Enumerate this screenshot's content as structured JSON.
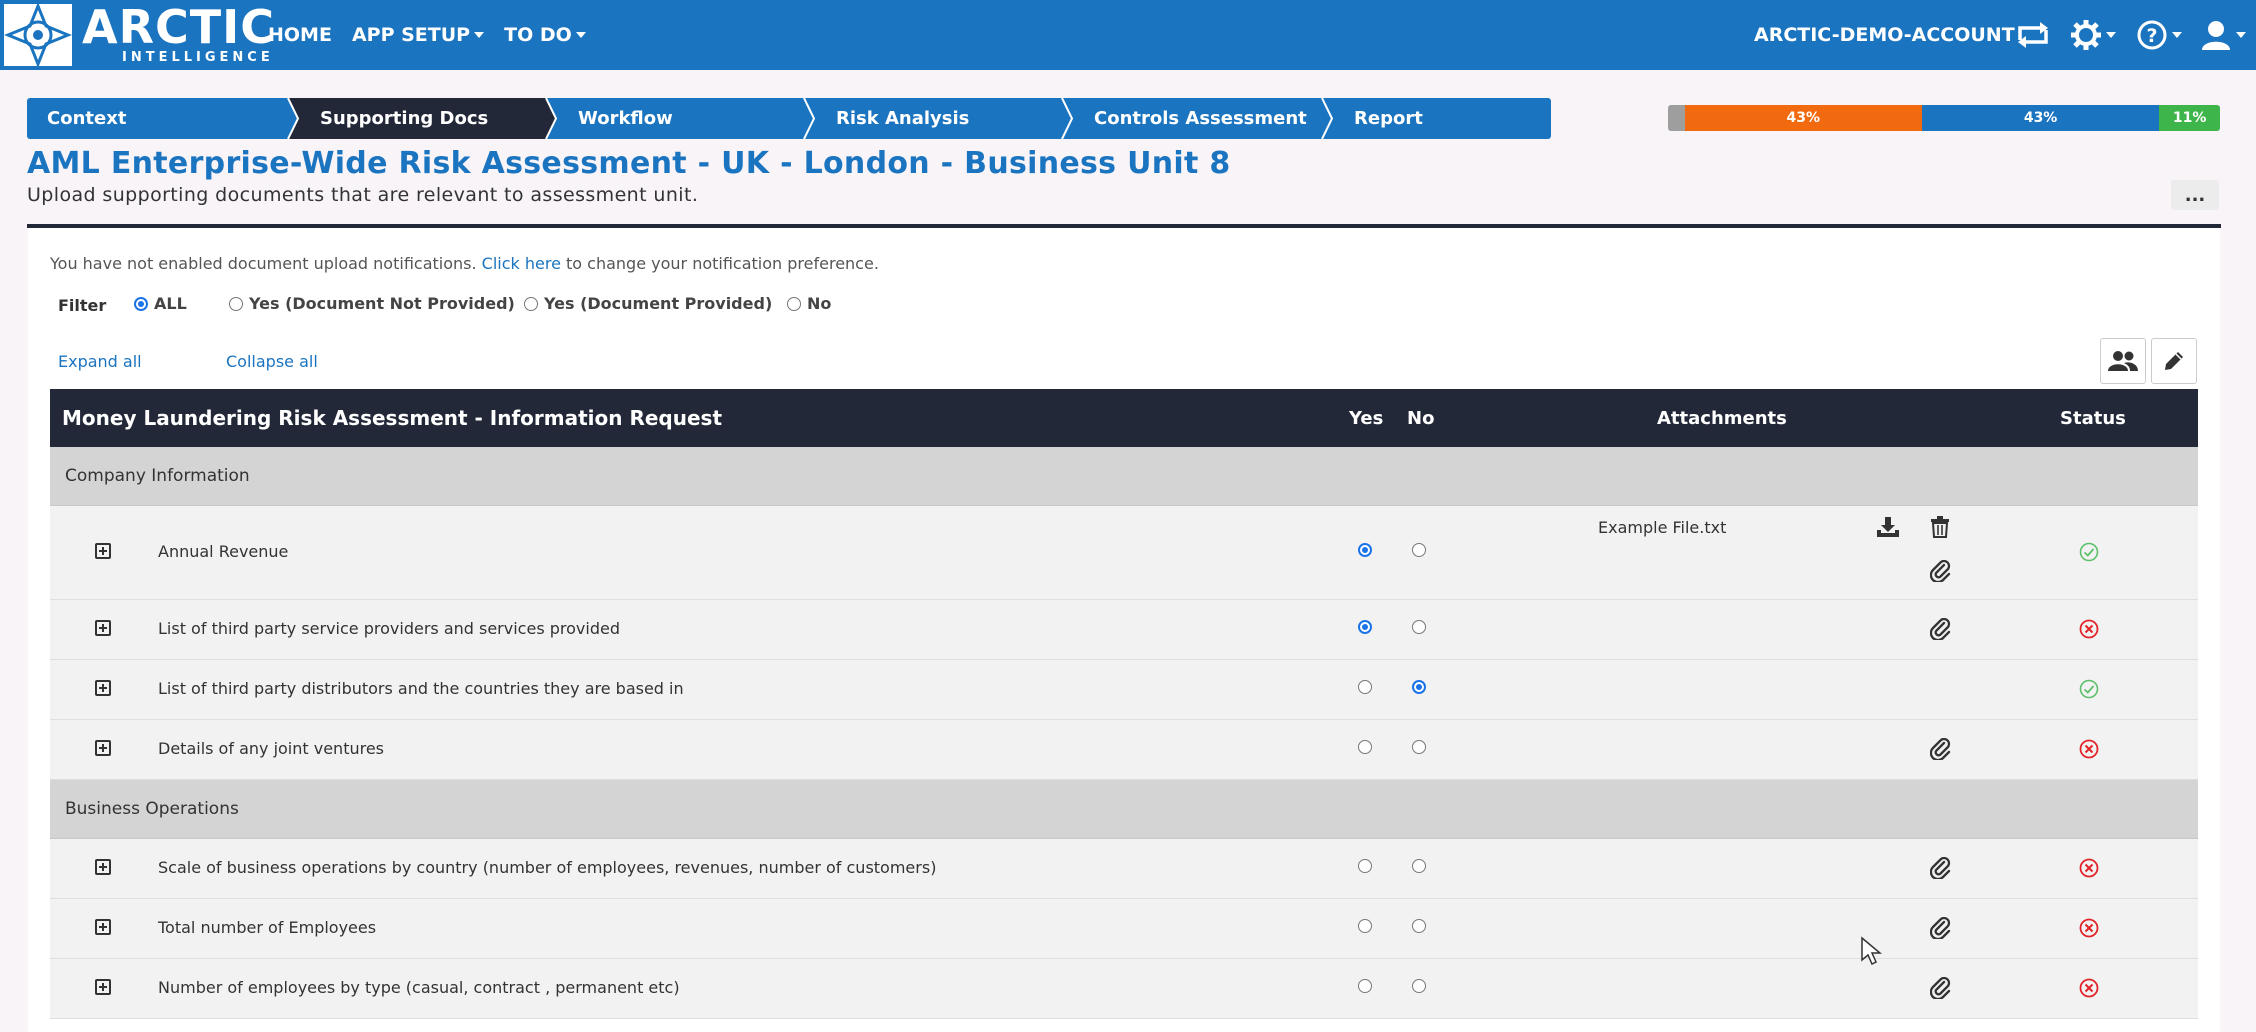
{
  "brand": {
    "name": "ARCTIC",
    "tagline": "INTELLIGENCE"
  },
  "nav": {
    "home": "HOME",
    "app_setup": "APP SETUP",
    "todo": "TO DO"
  },
  "account": {
    "name": "ARCTIC-DEMO-ACCOUNT"
  },
  "icons": {
    "switch": "switch-account-icon",
    "settings": "gear-icon",
    "help": "help-icon",
    "user": "user-icon",
    "download": "download-icon",
    "trash": "trash-icon",
    "attach": "paperclip-icon",
    "ok": "check-circle-icon",
    "missing": "x-circle-icon"
  },
  "steps": [
    "Context",
    "Supporting Docs",
    "Workflow",
    "Risk Analysis",
    "Controls Assessment",
    "Report"
  ],
  "active_step": 1,
  "progress": [
    {
      "label": "",
      "percent": 3,
      "color": "#9e9e9e"
    },
    {
      "label": "43%",
      "percent": 43,
      "color": "#f26a0f"
    },
    {
      "label": "43%",
      "percent": 43,
      "color": "#1b74c0"
    },
    {
      "label": "11%",
      "percent": 11,
      "color": "#3db54a"
    }
  ],
  "page": {
    "title": "AML Enterprise-Wide Risk Assessment - UK - London - Business Unit 8",
    "subtitle": "Upload supporting documents that are relevant to assessment unit.",
    "more_label": "..."
  },
  "notice": {
    "before": "You have not enabled document upload notifications.",
    "link": "Click here",
    "after": "to change your notification preference."
  },
  "filter": {
    "label": "Filter",
    "options": [
      "ALL",
      "Yes (Document Not Provided)",
      "Yes (Document Provided)",
      "No"
    ],
    "selected": "ALL"
  },
  "links": {
    "expand_all": "Expand all",
    "collapse_all": "Collapse all"
  },
  "table": {
    "title": "Money Laundering Risk Assessment - Information Request",
    "col_yes": "Yes",
    "col_no": "No",
    "col_attachments": "Attachments",
    "col_status": "Status",
    "sections": [
      {
        "name": "Company Information",
        "rows": [
          {
            "label": "Annual Revenue",
            "answer": "yes",
            "file": "Example File.txt",
            "status": "ok"
          },
          {
            "label": "List of third party service providers and services provided",
            "answer": "yes",
            "file": "",
            "status": "missing"
          },
          {
            "label": "List of third party distributors and the countries they are based in",
            "answer": "no",
            "file": "",
            "status": "ok"
          },
          {
            "label": "Details of any joint ventures",
            "answer": "",
            "file": "",
            "status": "missing"
          }
        ]
      },
      {
        "name": "Business Operations",
        "rows": [
          {
            "label": "Scale of business operations by country (number of employees, revenues, number of customers)",
            "answer": "",
            "file": "",
            "status": "missing"
          },
          {
            "label": "Total number of Employees",
            "answer": "",
            "file": "",
            "status": "missing"
          },
          {
            "label": "Number of employees by type (casual, contract , permanent etc)",
            "answer": "",
            "file": "",
            "status": "missing"
          }
        ]
      }
    ]
  }
}
